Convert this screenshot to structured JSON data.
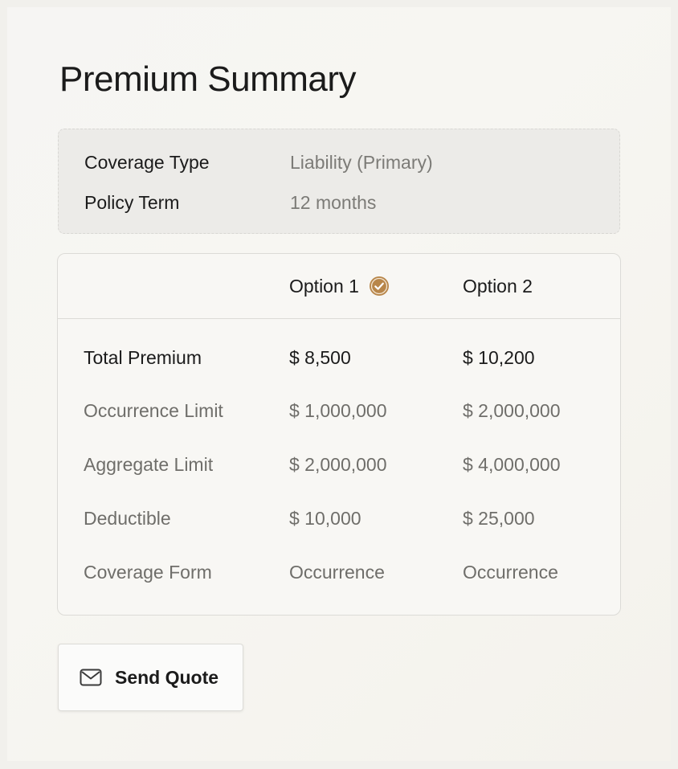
{
  "page": {
    "title": "Premium Summary"
  },
  "policy_info": {
    "coverage_type_label": "Coverage Type",
    "coverage_type_value": "Liability (Primary)",
    "policy_term_label": "Policy Term",
    "policy_term_value": "12 months"
  },
  "options": {
    "columns": [
      {
        "label": "Option 1",
        "selected": true
      },
      {
        "label": "Option 2",
        "selected": false
      }
    ],
    "rows": [
      {
        "label": "Total Premium",
        "option1": "$ 8,500",
        "option2": "$ 10,200"
      },
      {
        "label": "Occurrence Limit",
        "option1": "$ 1,000,000",
        "option2": "$ 2,000,000"
      },
      {
        "label": "Aggregate Limit",
        "option1": "$ 2,000,000",
        "option2": "$ 4,000,000"
      },
      {
        "label": "Deductible",
        "option1": "$ 10,000",
        "option2": "$ 25,000"
      },
      {
        "label": "Coverage Form",
        "option1": "Occurrence",
        "option2": "Occurrence"
      }
    ],
    "selected_icon": "check-circle-icon",
    "accent_color": "#b8864a"
  },
  "actions": {
    "send_quote_label": "Send Quote",
    "send_quote_icon": "mail-icon"
  }
}
